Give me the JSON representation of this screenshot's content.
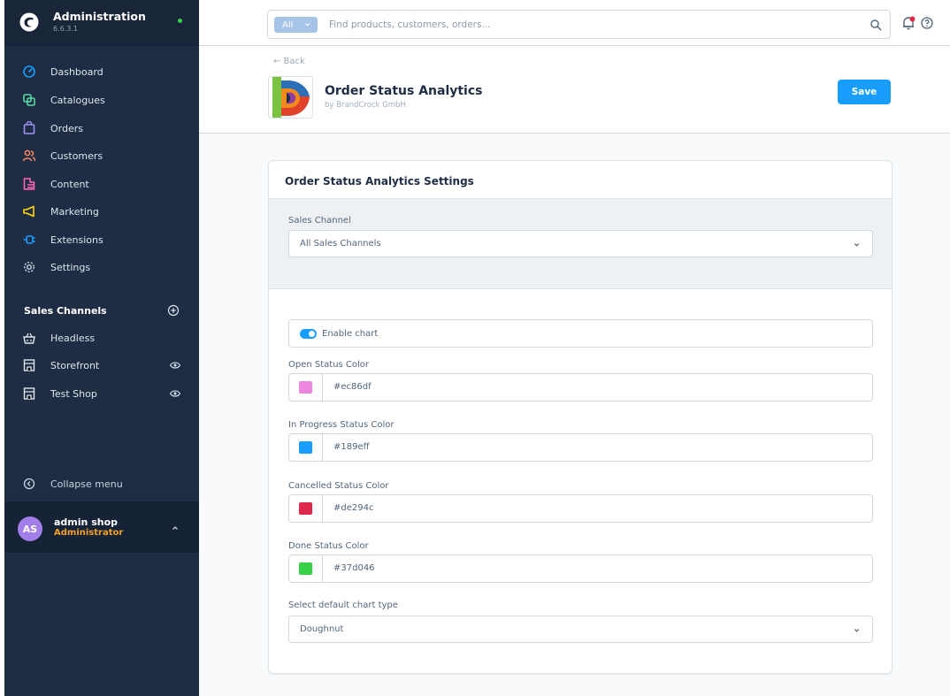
{
  "app": {
    "title": "Administration",
    "version": "6.6.3.1",
    "status_color": "#37d046"
  },
  "sidebar": {
    "items": [
      {
        "label": "Dashboard",
        "icon": "dashboard-icon",
        "color": "#189eff"
      },
      {
        "label": "Catalogues",
        "icon": "catalogue-icon",
        "color": "#57d9a3"
      },
      {
        "label": "Orders",
        "icon": "orders-bag-icon",
        "color": "#a092f0"
      },
      {
        "label": "Customers",
        "icon": "customers-icon",
        "color": "#f88962"
      },
      {
        "label": "Content",
        "icon": "content-icon",
        "color": "#ff68b4"
      },
      {
        "label": "Marketing",
        "icon": "marketing-megaphone-icon",
        "color": "#ffd700"
      },
      {
        "label": "Extensions",
        "icon": "extensions-plug-icon",
        "color": "#189eff"
      },
      {
        "label": "Settings",
        "icon": "settings-gear-icon",
        "color": "#9aa8b5"
      }
    ],
    "sales_channels_heading": "Sales Channels",
    "sales_channels": [
      {
        "label": "Headless",
        "icon": "headless-basket-icon",
        "visible_toggle": false
      },
      {
        "label": "Storefront",
        "icon": "storefront-icon",
        "visible_toggle": true
      },
      {
        "label": "Test Shop",
        "icon": "storefront-icon",
        "visible_toggle": true
      }
    ],
    "collapse_label": "Collapse menu",
    "user": {
      "initials": "AS",
      "name": "admin shop",
      "role": "Administrator"
    }
  },
  "topbar": {
    "search_type": "All",
    "search_placeholder": "Find products, customers, orders..."
  },
  "header": {
    "back_label": "← Back",
    "title": "Order Status Analytics",
    "subtitle": "by BrandCrock GmbH",
    "save_label": "Save"
  },
  "card": {
    "title": "Order Status Analytics Settings",
    "sales_channel_label": "Sales Channel",
    "sales_channel_value": "All Sales Channels",
    "enable_chart_label": "Enable chart",
    "enable_chart_on": true,
    "colors": [
      {
        "label": "Open Status Color",
        "value": "#ec86df"
      },
      {
        "label": "In Progress Status Color",
        "value": "#189eff"
      },
      {
        "label": "Cancelled Status Color",
        "value": "#de294c"
      },
      {
        "label": "Done Status Color",
        "value": "#37d046"
      }
    ],
    "chart_type_label": "Select default chart type",
    "chart_type_value": "Doughnut"
  }
}
